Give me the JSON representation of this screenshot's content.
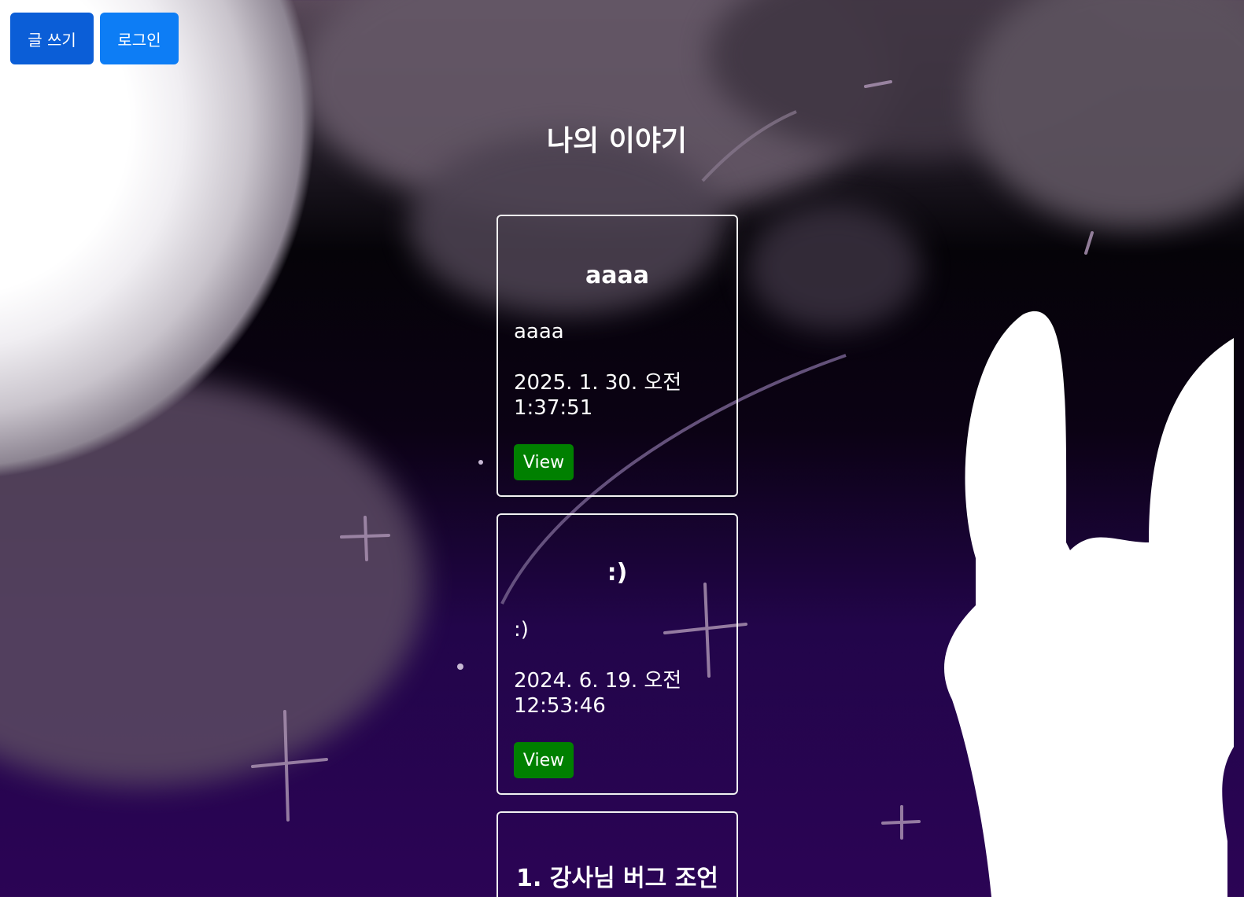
{
  "header": {
    "write_label": "글 쓰기",
    "login_label": "로그인"
  },
  "page_title": "나의 이야기",
  "posts": [
    {
      "title": "aaaa",
      "body": "aaaa",
      "date": "2025. 1. 30. 오전 1:37:51",
      "view_label": "View"
    },
    {
      "title": ":)",
      "body": ":)",
      "date": "2024. 6. 19. 오전 12:53:46",
      "view_label": "View"
    },
    {
      "title": "1. 강사님 버그 조언"
    }
  ],
  "colors": {
    "primary_button": "#0b5ed7",
    "view_button": "#008000",
    "background_deep": "#2b0455"
  }
}
